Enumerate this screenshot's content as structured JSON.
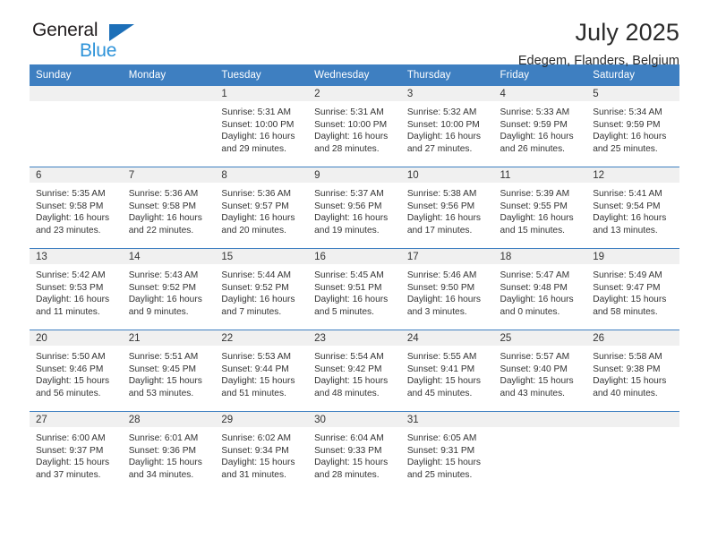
{
  "brand": {
    "name_top": "General",
    "name_bottom": "Blue",
    "color_dark": "#231f20",
    "color_blue": "#2e93d9",
    "triangle_color": "#1c6fb8"
  },
  "header": {
    "title": "July 2025",
    "subtitle": "Edegem, Flanders, Belgium"
  },
  "theme": {
    "header_row_bg": "#3e7fc1",
    "daynum_band_bg": "#f0f0f0",
    "text_color": "#333333"
  },
  "weekdays": [
    "Sunday",
    "Monday",
    "Tuesday",
    "Wednesday",
    "Thursday",
    "Friday",
    "Saturday"
  ],
  "weeks": [
    [
      {
        "day": "",
        "empty": true,
        "sunrise": "",
        "sunset": "",
        "daylight_line1": "",
        "daylight_line2": ""
      },
      {
        "day": "",
        "empty": true,
        "sunrise": "",
        "sunset": "",
        "daylight_line1": "",
        "daylight_line2": ""
      },
      {
        "day": "1",
        "empty": false,
        "sunrise": "Sunrise: 5:31 AM",
        "sunset": "Sunset: 10:00 PM",
        "daylight_line1": "Daylight: 16 hours",
        "daylight_line2": "and 29 minutes."
      },
      {
        "day": "2",
        "empty": false,
        "sunrise": "Sunrise: 5:31 AM",
        "sunset": "Sunset: 10:00 PM",
        "daylight_line1": "Daylight: 16 hours",
        "daylight_line2": "and 28 minutes."
      },
      {
        "day": "3",
        "empty": false,
        "sunrise": "Sunrise: 5:32 AM",
        "sunset": "Sunset: 10:00 PM",
        "daylight_line1": "Daylight: 16 hours",
        "daylight_line2": "and 27 minutes."
      },
      {
        "day": "4",
        "empty": false,
        "sunrise": "Sunrise: 5:33 AM",
        "sunset": "Sunset: 9:59 PM",
        "daylight_line1": "Daylight: 16 hours",
        "daylight_line2": "and 26 minutes."
      },
      {
        "day": "5",
        "empty": false,
        "sunrise": "Sunrise: 5:34 AM",
        "sunset": "Sunset: 9:59 PM",
        "daylight_line1": "Daylight: 16 hours",
        "daylight_line2": "and 25 minutes."
      }
    ],
    [
      {
        "day": "6",
        "empty": false,
        "sunrise": "Sunrise: 5:35 AM",
        "sunset": "Sunset: 9:58 PM",
        "daylight_line1": "Daylight: 16 hours",
        "daylight_line2": "and 23 minutes."
      },
      {
        "day": "7",
        "empty": false,
        "sunrise": "Sunrise: 5:36 AM",
        "sunset": "Sunset: 9:58 PM",
        "daylight_line1": "Daylight: 16 hours",
        "daylight_line2": "and 22 minutes."
      },
      {
        "day": "8",
        "empty": false,
        "sunrise": "Sunrise: 5:36 AM",
        "sunset": "Sunset: 9:57 PM",
        "daylight_line1": "Daylight: 16 hours",
        "daylight_line2": "and 20 minutes."
      },
      {
        "day": "9",
        "empty": false,
        "sunrise": "Sunrise: 5:37 AM",
        "sunset": "Sunset: 9:56 PM",
        "daylight_line1": "Daylight: 16 hours",
        "daylight_line2": "and 19 minutes."
      },
      {
        "day": "10",
        "empty": false,
        "sunrise": "Sunrise: 5:38 AM",
        "sunset": "Sunset: 9:56 PM",
        "daylight_line1": "Daylight: 16 hours",
        "daylight_line2": "and 17 minutes."
      },
      {
        "day": "11",
        "empty": false,
        "sunrise": "Sunrise: 5:39 AM",
        "sunset": "Sunset: 9:55 PM",
        "daylight_line1": "Daylight: 16 hours",
        "daylight_line2": "and 15 minutes."
      },
      {
        "day": "12",
        "empty": false,
        "sunrise": "Sunrise: 5:41 AM",
        "sunset": "Sunset: 9:54 PM",
        "daylight_line1": "Daylight: 16 hours",
        "daylight_line2": "and 13 minutes."
      }
    ],
    [
      {
        "day": "13",
        "empty": false,
        "sunrise": "Sunrise: 5:42 AM",
        "sunset": "Sunset: 9:53 PM",
        "daylight_line1": "Daylight: 16 hours",
        "daylight_line2": "and 11 minutes."
      },
      {
        "day": "14",
        "empty": false,
        "sunrise": "Sunrise: 5:43 AM",
        "sunset": "Sunset: 9:52 PM",
        "daylight_line1": "Daylight: 16 hours",
        "daylight_line2": "and 9 minutes."
      },
      {
        "day": "15",
        "empty": false,
        "sunrise": "Sunrise: 5:44 AM",
        "sunset": "Sunset: 9:52 PM",
        "daylight_line1": "Daylight: 16 hours",
        "daylight_line2": "and 7 minutes."
      },
      {
        "day": "16",
        "empty": false,
        "sunrise": "Sunrise: 5:45 AM",
        "sunset": "Sunset: 9:51 PM",
        "daylight_line1": "Daylight: 16 hours",
        "daylight_line2": "and 5 minutes."
      },
      {
        "day": "17",
        "empty": false,
        "sunrise": "Sunrise: 5:46 AM",
        "sunset": "Sunset: 9:50 PM",
        "daylight_line1": "Daylight: 16 hours",
        "daylight_line2": "and 3 minutes."
      },
      {
        "day": "18",
        "empty": false,
        "sunrise": "Sunrise: 5:47 AM",
        "sunset": "Sunset: 9:48 PM",
        "daylight_line1": "Daylight: 16 hours",
        "daylight_line2": "and 0 minutes."
      },
      {
        "day": "19",
        "empty": false,
        "sunrise": "Sunrise: 5:49 AM",
        "sunset": "Sunset: 9:47 PM",
        "daylight_line1": "Daylight: 15 hours",
        "daylight_line2": "and 58 minutes."
      }
    ],
    [
      {
        "day": "20",
        "empty": false,
        "sunrise": "Sunrise: 5:50 AM",
        "sunset": "Sunset: 9:46 PM",
        "daylight_line1": "Daylight: 15 hours",
        "daylight_line2": "and 56 minutes."
      },
      {
        "day": "21",
        "empty": false,
        "sunrise": "Sunrise: 5:51 AM",
        "sunset": "Sunset: 9:45 PM",
        "daylight_line1": "Daylight: 15 hours",
        "daylight_line2": "and 53 minutes."
      },
      {
        "day": "22",
        "empty": false,
        "sunrise": "Sunrise: 5:53 AM",
        "sunset": "Sunset: 9:44 PM",
        "daylight_line1": "Daylight: 15 hours",
        "daylight_line2": "and 51 minutes."
      },
      {
        "day": "23",
        "empty": false,
        "sunrise": "Sunrise: 5:54 AM",
        "sunset": "Sunset: 9:42 PM",
        "daylight_line1": "Daylight: 15 hours",
        "daylight_line2": "and 48 minutes."
      },
      {
        "day": "24",
        "empty": false,
        "sunrise": "Sunrise: 5:55 AM",
        "sunset": "Sunset: 9:41 PM",
        "daylight_line1": "Daylight: 15 hours",
        "daylight_line2": "and 45 minutes."
      },
      {
        "day": "25",
        "empty": false,
        "sunrise": "Sunrise: 5:57 AM",
        "sunset": "Sunset: 9:40 PM",
        "daylight_line1": "Daylight: 15 hours",
        "daylight_line2": "and 43 minutes."
      },
      {
        "day": "26",
        "empty": false,
        "sunrise": "Sunrise: 5:58 AM",
        "sunset": "Sunset: 9:38 PM",
        "daylight_line1": "Daylight: 15 hours",
        "daylight_line2": "and 40 minutes."
      }
    ],
    [
      {
        "day": "27",
        "empty": false,
        "sunrise": "Sunrise: 6:00 AM",
        "sunset": "Sunset: 9:37 PM",
        "daylight_line1": "Daylight: 15 hours",
        "daylight_line2": "and 37 minutes."
      },
      {
        "day": "28",
        "empty": false,
        "sunrise": "Sunrise: 6:01 AM",
        "sunset": "Sunset: 9:36 PM",
        "daylight_line1": "Daylight: 15 hours",
        "daylight_line2": "and 34 minutes."
      },
      {
        "day": "29",
        "empty": false,
        "sunrise": "Sunrise: 6:02 AM",
        "sunset": "Sunset: 9:34 PM",
        "daylight_line1": "Daylight: 15 hours",
        "daylight_line2": "and 31 minutes."
      },
      {
        "day": "30",
        "empty": false,
        "sunrise": "Sunrise: 6:04 AM",
        "sunset": "Sunset: 9:33 PM",
        "daylight_line1": "Daylight: 15 hours",
        "daylight_line2": "and 28 minutes."
      },
      {
        "day": "31",
        "empty": false,
        "sunrise": "Sunrise: 6:05 AM",
        "sunset": "Sunset: 9:31 PM",
        "daylight_line1": "Daylight: 15 hours",
        "daylight_line2": "and 25 minutes."
      },
      {
        "day": "",
        "empty": true,
        "sunrise": "",
        "sunset": "",
        "daylight_line1": "",
        "daylight_line2": ""
      },
      {
        "day": "",
        "empty": true,
        "sunrise": "",
        "sunset": "",
        "daylight_line1": "",
        "daylight_line2": ""
      }
    ]
  ]
}
